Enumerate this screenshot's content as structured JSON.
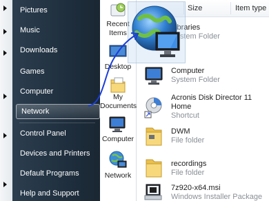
{
  "start_menu": {
    "items": [
      {
        "label": "Pictures",
        "has_arrow": true
      },
      {
        "label": "Music",
        "has_arrow": true
      },
      {
        "label": "Downloads",
        "has_arrow": true
      },
      {
        "label": "Games",
        "has_arrow": false
      },
      {
        "label": "Computer",
        "has_arrow": true
      },
      {
        "label": "Network",
        "has_arrow": false
      },
      {
        "label": "Control Panel",
        "has_arrow": true
      },
      {
        "label": "Devices and Printers",
        "has_arrow": false
      },
      {
        "label": "Default Programs",
        "has_arrow": false
      },
      {
        "label": "Help and Support",
        "has_arrow": true
      }
    ],
    "selected": "Network"
  },
  "nav_pane": {
    "items": [
      {
        "label_line1": "Recent",
        "label_line2": "Items",
        "icon": "recent-items-icon"
      },
      {
        "label_line1": "Desktop",
        "label_line2": "",
        "icon": "desktop-icon"
      },
      {
        "label_line1": "My",
        "label_line2": "Documents",
        "icon": "my-documents-icon"
      },
      {
        "label_line1": "Computer",
        "label_line2": "",
        "icon": "computer-icon"
      },
      {
        "label_line1": "Network",
        "label_line2": "",
        "icon": "network-icon"
      }
    ]
  },
  "file_list": {
    "columns": {
      "size": "Size",
      "item_type": "Item type"
    },
    "rows": [
      {
        "name": "Libraries",
        "line2": "System Folder",
        "line3": "",
        "icon": "libraries-icon"
      },
      {
        "name": "Computer",
        "line2": "System Folder",
        "line3": "",
        "icon": "computer-icon"
      },
      {
        "name": "Acronis Disk Director 11",
        "line2": "Home",
        "line3": "Shortcut",
        "icon": "acronis-icon"
      },
      {
        "name": "DWM",
        "line2": "File folder",
        "line3": "",
        "icon": "folder-icon"
      },
      {
        "name": "recordings",
        "line2": "File folder",
        "line3": "",
        "icon": "folder-icon"
      },
      {
        "name": "7z920-x64.msi",
        "line2": "Windows Installer Package",
        "line3": "",
        "icon": "msi-icon"
      }
    ]
  },
  "colors": {
    "start_menu_bg": "#22313f",
    "accent_blue": "#1a3ed8",
    "folder_yellow": "#f2cf6a"
  }
}
